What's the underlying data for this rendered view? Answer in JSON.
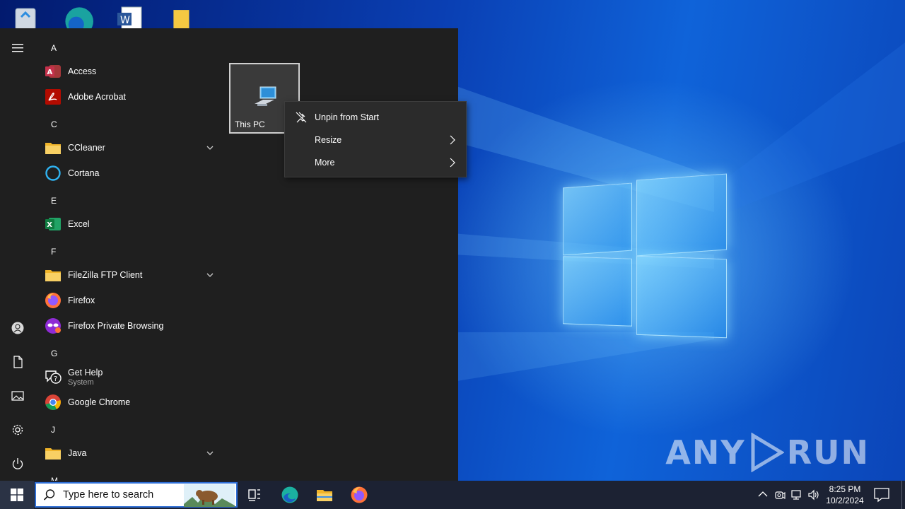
{
  "start_menu": {
    "letters": [
      "A",
      "C",
      "E",
      "F",
      "G",
      "J",
      "M"
    ],
    "apps": [
      {
        "label": "Access",
        "icon": "access-icon"
      },
      {
        "label": "Adobe Acrobat",
        "icon": "acrobat-icon"
      },
      {
        "label": "CCleaner",
        "icon": "folder-icon",
        "expandable": true
      },
      {
        "label": "Cortana",
        "icon": "cortana-icon"
      },
      {
        "label": "Excel",
        "icon": "excel-icon"
      },
      {
        "label": "FileZilla FTP Client",
        "icon": "folder-icon",
        "expandable": true
      },
      {
        "label": "Firefox",
        "icon": "firefox-icon"
      },
      {
        "label": "Firefox Private Browsing",
        "icon": "firefox-private-icon"
      },
      {
        "label": "Get Help",
        "sublabel": "System",
        "icon": "get-help-icon"
      },
      {
        "label": "Google Chrome",
        "icon": "chrome-icon"
      },
      {
        "label": "Java",
        "icon": "folder-icon",
        "expandable": true
      }
    ],
    "tile": {
      "label": "This PC",
      "icon": "computer-icon"
    },
    "context_menu": [
      {
        "label": "Unpin from Start",
        "icon": "unpin-icon"
      },
      {
        "label": "Resize",
        "submenu": true
      },
      {
        "label": "More",
        "submenu": true
      }
    ]
  },
  "taskbar": {
    "search_placeholder": "Type here to search",
    "pinned": [
      "task-view-icon",
      "edge-icon",
      "file-explorer-icon",
      "firefox-icon"
    ],
    "clock_time": "8:25 PM",
    "clock_date": "10/2/2024"
  },
  "watermark": {
    "left": "ANY",
    "right": "RUN"
  },
  "colors": {
    "start_bg": "#1f1f1f",
    "taskbar_bg": "#1c2233",
    "context_bg": "#2b2b2b",
    "accent": "#2f6fd6"
  }
}
